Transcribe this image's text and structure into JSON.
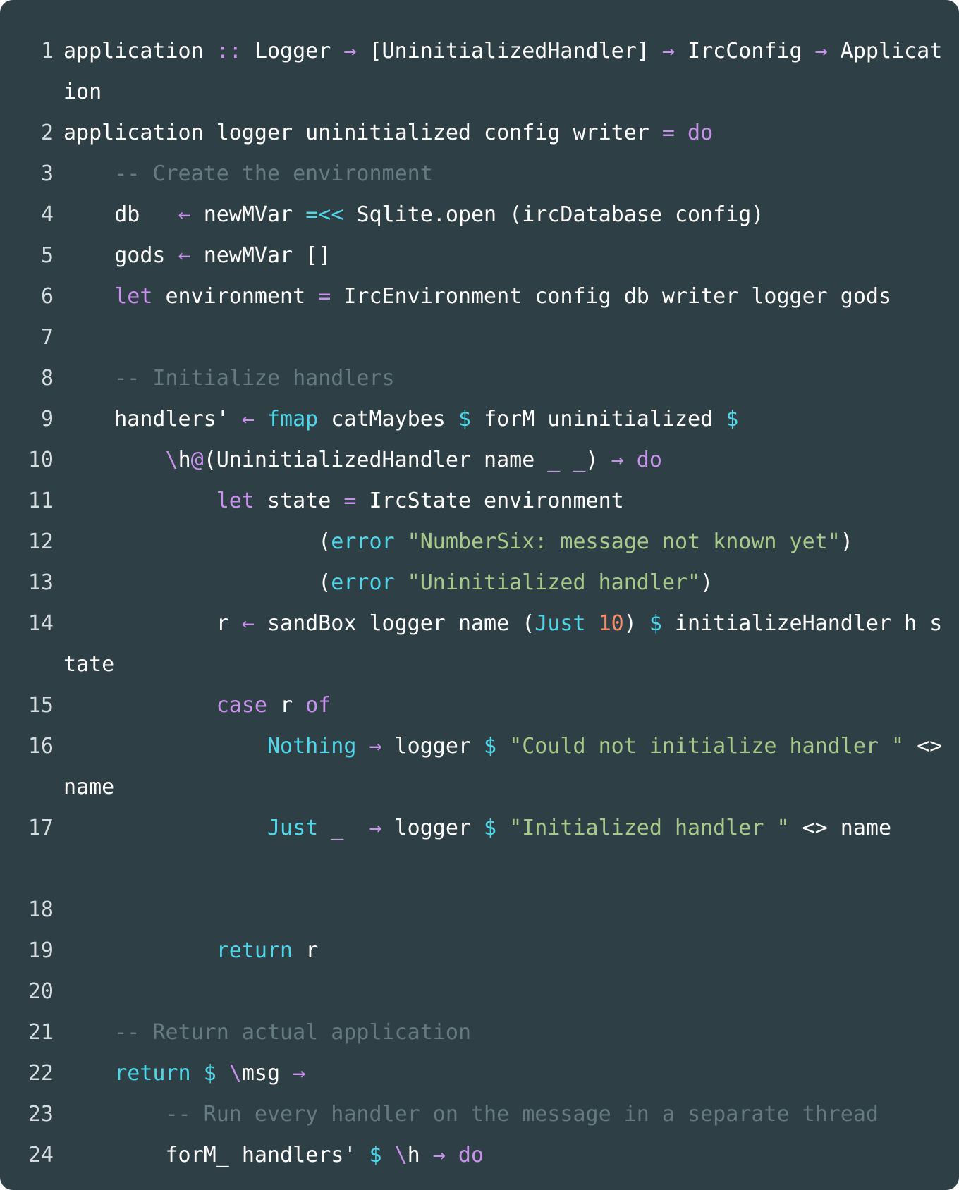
{
  "lines": [
    {
      "n": "1",
      "tokens": [
        [
          "",
          "application "
        ],
        [
          "op",
          ":: "
        ],
        [
          "",
          "Logger "
        ],
        [
          "op",
          "→ "
        ],
        [
          "",
          "[UninitializedHandler] "
        ],
        [
          "op",
          "→ "
        ],
        [
          "",
          "IrcConfig "
        ],
        [
          "op",
          "→ "
        ],
        [
          "",
          "Application"
        ]
      ],
      "wrap": true
    },
    {
      "n": "2",
      "tokens": [
        [
          "",
          "application logger uninitialized config writer "
        ],
        [
          "op",
          "= "
        ],
        [
          "kw",
          "do"
        ]
      ]
    },
    {
      "n": "3",
      "tokens": [
        [
          "",
          "    "
        ],
        [
          "cmt",
          "-- Create the environment"
        ]
      ]
    },
    {
      "n": "4",
      "tokens": [
        [
          "",
          "    db   "
        ],
        [
          "op",
          "← "
        ],
        [
          "",
          "newMVar "
        ],
        [
          "fn",
          "=<< "
        ],
        [
          "",
          "Sqlite.open (ircDatabase config)"
        ]
      ]
    },
    {
      "n": "5",
      "tokens": [
        [
          "",
          "    gods "
        ],
        [
          "op",
          "← "
        ],
        [
          "",
          "newMVar []"
        ]
      ]
    },
    {
      "n": "6",
      "tokens": [
        [
          "",
          "    "
        ],
        [
          "kw",
          "let "
        ],
        [
          "",
          "environment "
        ],
        [
          "op",
          "= "
        ],
        [
          "",
          "IrcEnvironment config db writer logger gods"
        ]
      ]
    },
    {
      "n": "7",
      "tokens": []
    },
    {
      "n": "8",
      "tokens": [
        [
          "",
          "    "
        ],
        [
          "cmt",
          "-- Initialize handlers"
        ]
      ]
    },
    {
      "n": "9",
      "tokens": [
        [
          "",
          "    handlers' "
        ],
        [
          "op",
          "← "
        ],
        [
          "fn",
          "fmap "
        ],
        [
          "",
          "catMaybes "
        ],
        [
          "sym",
          "$ "
        ],
        [
          "",
          "forM uninitialized "
        ],
        [
          "sym",
          "$"
        ]
      ]
    },
    {
      "n": "10",
      "tokens": [
        [
          "",
          "        "
        ],
        [
          "op",
          "\\"
        ],
        [
          "",
          "h"
        ],
        [
          "op",
          "@"
        ],
        [
          "",
          "(UninitializedHandler name "
        ],
        [
          "op",
          "_ _"
        ],
        [
          "",
          ") "
        ],
        [
          "op",
          "→ "
        ],
        [
          "kw",
          "do"
        ]
      ]
    },
    {
      "n": "11",
      "tokens": [
        [
          "",
          "            "
        ],
        [
          "kw",
          "let "
        ],
        [
          "",
          "state "
        ],
        [
          "op",
          "= "
        ],
        [
          "",
          "IrcState environment"
        ]
      ]
    },
    {
      "n": "12",
      "tokens": [
        [
          "",
          "                    ("
        ],
        [
          "fn",
          "error "
        ],
        [
          "str",
          "\"NumberSix: message not known yet\""
        ],
        [
          "",
          ")"
        ]
      ]
    },
    {
      "n": "13",
      "tokens": [
        [
          "",
          "                    ("
        ],
        [
          "fn",
          "error "
        ],
        [
          "str",
          "\"Uninitialized handler\""
        ],
        [
          "",
          ")"
        ]
      ]
    },
    {
      "n": "14",
      "tokens": [
        [
          "",
          "            r "
        ],
        [
          "op",
          "← "
        ],
        [
          "",
          "sandBox logger name ("
        ],
        [
          "fn",
          "Just "
        ],
        [
          "num",
          "10"
        ],
        [
          "",
          ") "
        ],
        [
          "sym",
          "$"
        ],
        [
          "",
          " initializeHandler h state"
        ]
      ],
      "wrap": true
    },
    {
      "n": "15",
      "tokens": [
        [
          "",
          "            "
        ],
        [
          "kw",
          "case "
        ],
        [
          "",
          "r "
        ],
        [
          "kw",
          "of"
        ]
      ]
    },
    {
      "n": "16",
      "tokens": [
        [
          "",
          "                "
        ],
        [
          "fn",
          "Nothing "
        ],
        [
          "op",
          "→ "
        ],
        [
          "",
          "logger "
        ],
        [
          "sym",
          "$ "
        ],
        [
          "str",
          "\"Could not initialize handler \""
        ],
        [
          "",
          " <> name"
        ]
      ],
      "wrap": true
    },
    {
      "n": "17",
      "tokens": [
        [
          "",
          "                "
        ],
        [
          "fn",
          "Just "
        ],
        [
          "op",
          "_  "
        ],
        [
          "op",
          "→ "
        ],
        [
          "",
          "logger "
        ],
        [
          "sym",
          "$ "
        ],
        [
          "str",
          "\"Initialized handler \""
        ],
        [
          "",
          " <> name"
        ]
      ],
      "wrap": true
    },
    {
      "n": "18",
      "tokens": []
    },
    {
      "n": "19",
      "tokens": [
        [
          "",
          "            "
        ],
        [
          "fn",
          "return "
        ],
        [
          "",
          "r"
        ]
      ]
    },
    {
      "n": "20",
      "tokens": []
    },
    {
      "n": "21",
      "tokens": [
        [
          "",
          "    "
        ],
        [
          "cmt",
          "-- Return actual application"
        ]
      ]
    },
    {
      "n": "22",
      "tokens": [
        [
          "",
          "    "
        ],
        [
          "fn",
          "return "
        ],
        [
          "sym",
          "$ "
        ],
        [
          "op",
          "\\"
        ],
        [
          "",
          "msg "
        ],
        [
          "op",
          "→"
        ]
      ]
    },
    {
      "n": "23",
      "tokens": [
        [
          "",
          "        "
        ],
        [
          "cmt",
          "-- Run every handler on the message in a separate thread"
        ]
      ]
    },
    {
      "n": "24",
      "tokens": [
        [
          "",
          "        forM_ handlers' "
        ],
        [
          "sym",
          "$ "
        ],
        [
          "op",
          "\\"
        ],
        [
          "",
          "h "
        ],
        [
          "op",
          "→ "
        ],
        [
          "kw",
          "do"
        ]
      ]
    }
  ]
}
